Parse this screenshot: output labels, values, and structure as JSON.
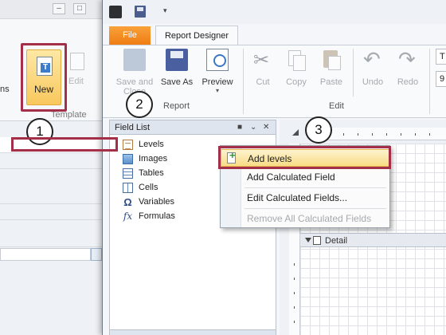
{
  "background_window": {
    "partial_label": "ns",
    "new_label": "New",
    "edit_label": "Edit",
    "group_label": "Template"
  },
  "callouts": [
    "1",
    "2",
    "3"
  ],
  "window": {
    "tabs": {
      "file": "File",
      "report_designer": "Report Designer"
    },
    "ribbon": {
      "report_group": {
        "label": "Report",
        "save_and_close": [
          "Save and",
          "Close"
        ],
        "save_as": "Save As",
        "preview": "Preview"
      },
      "edit_group": {
        "label": "Edit",
        "cut": "Cut",
        "copy": "Copy",
        "paste": "Paste",
        "undo": "Undo",
        "redo": "Redo"
      },
      "partial_box_top": "T",
      "partial_box_bottom": "9"
    }
  },
  "field_list": {
    "title": "Field List",
    "items": [
      {
        "label": "Levels",
        "icon": "levels-icon"
      },
      {
        "label": "Images",
        "icon": "images-icon"
      },
      {
        "label": "Tables",
        "icon": "tables-icon"
      },
      {
        "label": "Cells",
        "icon": "cells-icon"
      },
      {
        "label": "Variables",
        "icon": "variables-icon"
      },
      {
        "label": "Formulas",
        "icon": "formulas-icon"
      }
    ]
  },
  "designer": {
    "detail_band": "Detail"
  },
  "context_menu": {
    "items": [
      {
        "label": "Add levels",
        "enabled": true,
        "highlighted": true
      },
      {
        "label": "Add Calculated Field",
        "enabled": true
      },
      {
        "label": "Edit Calculated Fields...",
        "enabled": true
      },
      {
        "label": "Remove All Calculated Fields",
        "enabled": false
      }
    ]
  },
  "colors": {
    "highlight_box": "#a33048",
    "file_tab": "#ef7d13",
    "menu_highlight": "#f8dc85"
  }
}
